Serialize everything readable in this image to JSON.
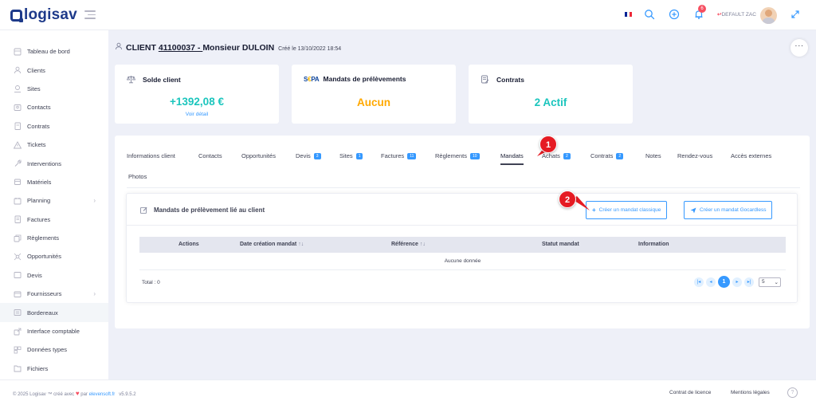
{
  "header": {
    "logo_text": "logisav",
    "notif_count": "6",
    "user_name": "DEFAULT ZAC"
  },
  "sidebar": {
    "items": [
      {
        "label": "Tableau de bord",
        "icon": "tableau-de-bord-icon"
      },
      {
        "label": "Clients",
        "icon": "clients-icon"
      },
      {
        "label": "Sites",
        "icon": "sites-icon"
      },
      {
        "label": "Contacts",
        "icon": "contacts-icon"
      },
      {
        "label": "Contrats",
        "icon": "contrats-icon"
      },
      {
        "label": "Tickets",
        "icon": "tickets-icon"
      },
      {
        "label": "Interventions",
        "icon": "interventions-icon"
      },
      {
        "label": "Matériels",
        "icon": "materiels-icon"
      },
      {
        "label": "Planning",
        "icon": "planning-icon"
      },
      {
        "label": "Factures",
        "icon": "factures-icon"
      },
      {
        "label": "Règlements",
        "icon": "reglements-icon"
      },
      {
        "label": "Opportunités",
        "icon": "opportunites-icon"
      },
      {
        "label": "Devis",
        "icon": "devis-icon"
      },
      {
        "label": "Fournisseurs",
        "icon": "fournisseurs-icon"
      },
      {
        "label": "Bordereaux",
        "icon": "bordereaux-icon"
      },
      {
        "label": "Interface comptable",
        "icon": "interface-comptable-icon"
      },
      {
        "label": "Données types",
        "icon": "donnees-types-icon"
      },
      {
        "label": "Fichiers",
        "icon": "fichiers-icon"
      }
    ]
  },
  "page": {
    "title_prefix": "CLIENT ",
    "client_code": "41100037 - ",
    "client_name": "Monsieur DULOIN",
    "created": "Créé le 13/10/2022 18:54",
    "more": "···"
  },
  "cards": {
    "solde": {
      "title": "Solde client",
      "value": "+1392,08 €",
      "link": "Voir détail",
      "color": "#1bc5bd"
    },
    "mandats": {
      "logo": "SEPA",
      "title": "Mandats de prélèvements",
      "value": "Aucun",
      "color": "#ffa800"
    },
    "contrats": {
      "title": "Contrats",
      "value": "2 Actif",
      "color": "#1bc5bd"
    }
  },
  "tabs": [
    {
      "label": "Informations client",
      "badge": ""
    },
    {
      "label": "Contacts",
      "badge": ""
    },
    {
      "label": "Opportunités",
      "badge": ""
    },
    {
      "label": "Devis",
      "badge": "3"
    },
    {
      "label": "Sites",
      "badge": "1"
    },
    {
      "label": "Factures",
      "badge": "11"
    },
    {
      "label": "Règlements",
      "badge": "10"
    },
    {
      "label": "Mandats",
      "badge": ""
    },
    {
      "label": "Achats",
      "badge": "2"
    },
    {
      "label": "Contrats",
      "badge": "2"
    },
    {
      "label": "Notes",
      "badge": ""
    },
    {
      "label": "Rendez-vous",
      "badge": ""
    },
    {
      "label": "Accès externes",
      "badge": ""
    },
    {
      "label": "Photos",
      "badge": ""
    }
  ],
  "mandats_section": {
    "title": "Mandats de prélèvement lié au client",
    "btn_classic": "Créer un mandat classique",
    "btn_gocardless": "Créer un mandat Gocardless",
    "columns": [
      "Actions",
      "Date création mandat",
      "Référence",
      "Statut mandat",
      "Information"
    ],
    "sort_glyph": "↑↓",
    "empty": "Aucune donnée",
    "total": "Total : 0",
    "current_page": "1",
    "page_size": "5"
  },
  "markers": {
    "m1": "1",
    "m2": "2"
  },
  "footer": {
    "copyright": "© 2025 Logisav ™ créé avec",
    "by": "par",
    "company": "elevensoft.fr",
    "version": "v5.9.5.2",
    "license": "Contrat de licence",
    "legal": "Mentions légales",
    "help": "?"
  },
  "colors": {
    "primary": "#3699ff",
    "success": "#1bc5bd",
    "warning": "#ffa800",
    "danger": "#f64e60"
  }
}
